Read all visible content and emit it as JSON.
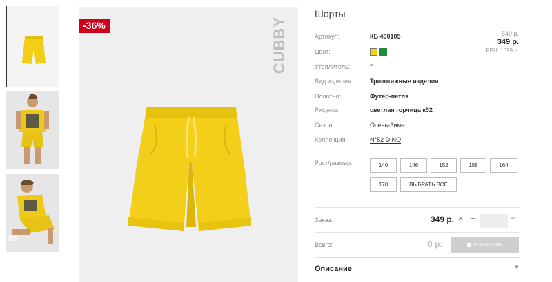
{
  "product": {
    "discount": "-36%",
    "brand": "CUBBY",
    "title": "Шорты"
  },
  "attributes": [
    {
      "label": "Артикул:",
      "value": "КБ 400105"
    },
    {
      "label": "Цвет:",
      "value": ""
    },
    {
      "label": "Утеплитель:",
      "value": "\""
    },
    {
      "label": "Вид изделия:",
      "value": "Трикотажные изделия"
    },
    {
      "label": "Полотно:",
      "value": "Футер-петля"
    },
    {
      "label": "Рисунок:",
      "value": "светлая горчица к52"
    },
    {
      "label": "Сезон:",
      "value": "Осень-Зима"
    },
    {
      "label": "Коллекция:",
      "value": "N°52 DINO"
    }
  ],
  "colors": {
    "swatch_yellow": "#f5d21b",
    "swatch_green": "#1e8a3c",
    "discount_badge": "#d0021b"
  },
  "pricing": {
    "old_price": "549 р.",
    "price": "349 р.",
    "rrc": "РРЦ: 1099 р."
  },
  "sizes": {
    "label": "Рост/размер:",
    "options": [
      "140",
      "146",
      "152",
      "158",
      "164",
      "170"
    ],
    "select_all": "ВЫБРАТЬ ВСЕ"
  },
  "order": {
    "label": "Заказ:",
    "price": "349 р.",
    "clear_icon": "×",
    "minus": "–",
    "plus": "+",
    "quantity": ""
  },
  "total": {
    "label": "Всего:",
    "value": "0 р.",
    "cart_button": "В КОРЗИНУ"
  },
  "description": {
    "title": "Описание",
    "arrow": "▼"
  }
}
